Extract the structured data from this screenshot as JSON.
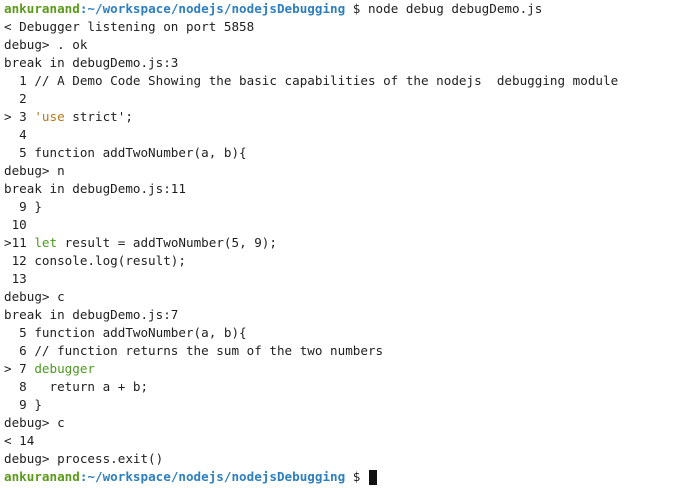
{
  "prompt1": {
    "user": "ankuranand",
    "path": ":~/workspace/nodejs/nodejsDebugging",
    "symbol": " $ ",
    "command": "node debug debugDemo.js"
  },
  "lines": [
    "< Debugger listening on port 5858",
    "debug> . ok",
    "break in debugDemo.js:3",
    "  1 // A Demo Code Showing the basic capabilities of the nodejs  debugging module",
    "  2",
    "> 3 ",
    "  4",
    "  5 function addTwoNumber(a, b){",
    "debug> n",
    "break in debugDemo.js:11",
    "  9 }",
    " 10",
    ">11 ",
    " 12 console.log(result);",
    " 13",
    "debug> c",
    "break in debugDemo.js:7",
    "  5 function addTwoNumber(a, b){",
    "  6 // function returns the sum of the two numbers",
    "> 7 ",
    "  8   return a + b;",
    "  9 }",
    "debug> c",
    "< 14",
    "debug> process.exit()"
  ],
  "tokens": {
    "use_strict_str": "'use",
    "use_strict_rest": " strict';",
    "let_kw": "let",
    "let_rest": " result = addTwoNumber(5, 9);",
    "debugger_kw": "debugger"
  },
  "prompt2": {
    "user": "ankuranand",
    "path": ":~/workspace/nodejs/nodejsDebugging",
    "symbol": " $ "
  },
  "colors": {
    "user": "#5b9b1a",
    "path": "#2e7fbf",
    "keyword": "#4b9a1e",
    "string": "#b5771b",
    "text": "#1f1f1f",
    "background": "#ffffff"
  }
}
